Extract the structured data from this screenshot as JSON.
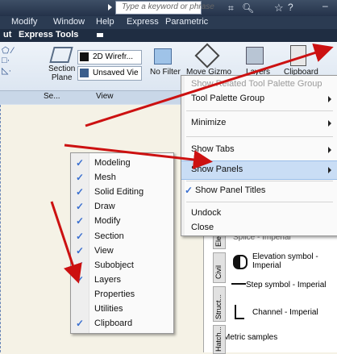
{
  "window": {
    "search_placeholder": "Type a keyword or phrase",
    "menu": [
      "Modify",
      "Window",
      "Help",
      "Express",
      "Parametric"
    ],
    "tabs": [
      "ut",
      "Express Tools"
    ]
  },
  "ribbon": {
    "section_plane": "Section\nPlane",
    "wireframe": "2D Wirefr...",
    "unsaved_view": "Unsaved Vie",
    "no_filter": "No Filter",
    "move_gizmo": "Move Gizmo",
    "layers": "Layers",
    "clipboard": "Clipboard",
    "panel_se": "Se...",
    "panel_view": "View"
  },
  "context_menu": {
    "items": [
      {
        "label": "Show Related Tool Palette Group",
        "disabled": true
      },
      {
        "label": "Tool Palette Group",
        "submenu": true
      },
      {
        "label": "Minimize",
        "submenu": true
      },
      {
        "label": "Show Tabs",
        "submenu": true
      },
      {
        "label": "Show Panels",
        "submenu": true,
        "highlighted": true
      },
      {
        "label": "Show Panel Titles",
        "checked": true
      },
      {
        "label": "Undock"
      },
      {
        "label": "Close"
      }
    ]
  },
  "panels_menu": {
    "items": [
      {
        "label": "Modeling",
        "checked": true
      },
      {
        "label": "Mesh",
        "checked": true
      },
      {
        "label": "Solid Editing",
        "checked": true
      },
      {
        "label": "Draw",
        "checked": true
      },
      {
        "label": "Modify",
        "checked": true
      },
      {
        "label": "Section",
        "checked": true
      },
      {
        "label": "View",
        "checked": true
      },
      {
        "label": "Subobject",
        "checked": true
      },
      {
        "label": "Layers",
        "checked": true
      },
      {
        "label": "Properties",
        "checked": false
      },
      {
        "label": "Utilities",
        "checked": false
      },
      {
        "label": "Clipboard",
        "checked": true
      }
    ]
  },
  "tool_palette": {
    "tabs": [
      "Elec",
      "Civil",
      "Struct...",
      "Hatch..."
    ],
    "items": [
      "Splice - Imperial",
      "Elevation symbol - Imperial",
      "Step symbol - Imperial",
      "Channel - Imperial",
      "Metric samples"
    ]
  },
  "colors": {
    "arrow": "#cc1111",
    "highlight": "#c9ddf5",
    "check": "#3a6fd0"
  }
}
